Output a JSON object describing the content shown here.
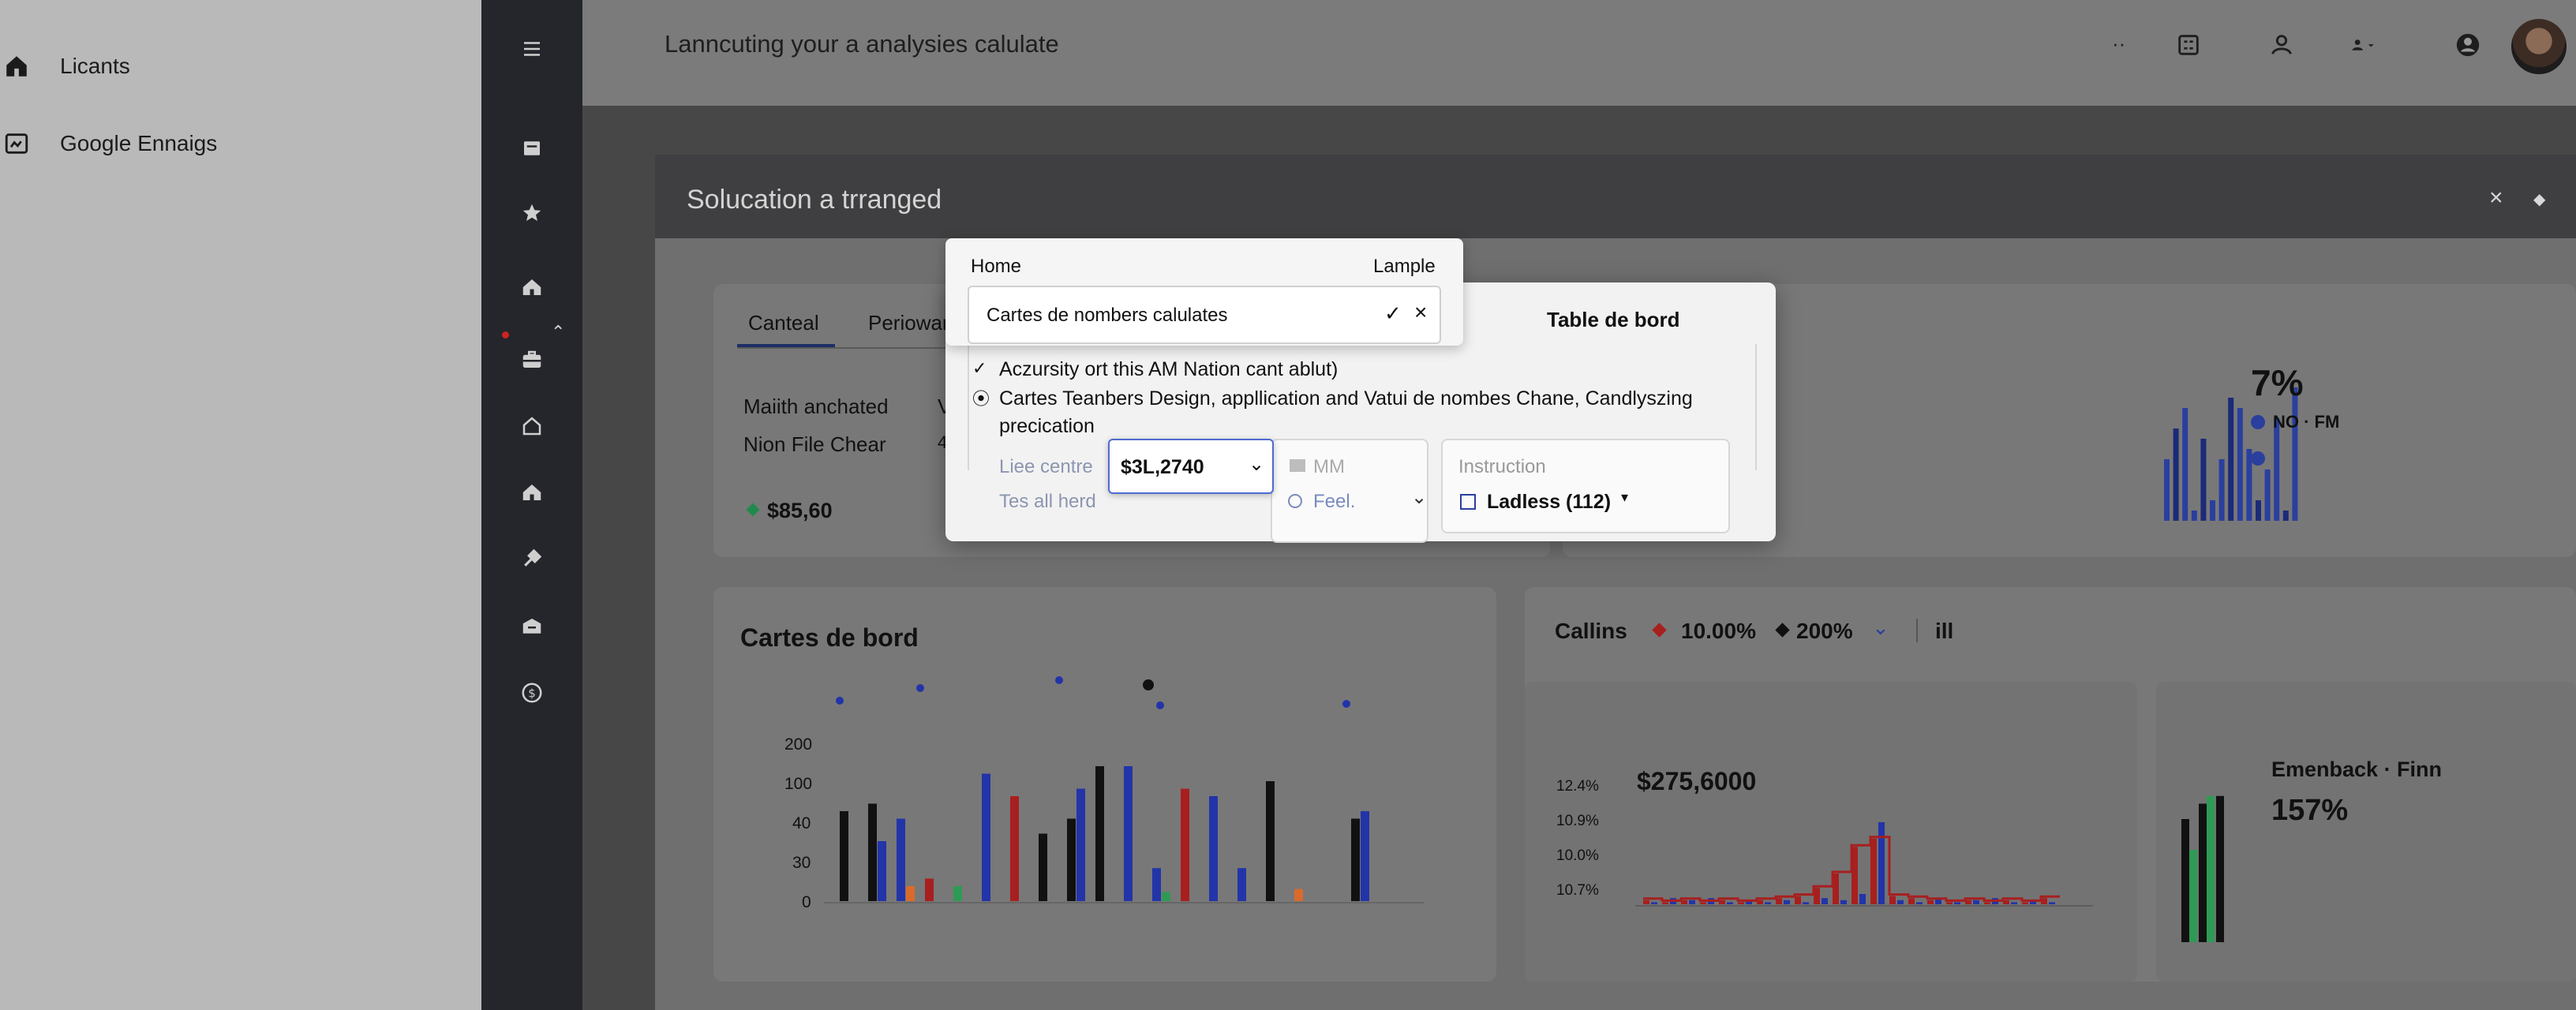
{
  "leftpanel": {
    "items": [
      {
        "label": "Licants",
        "icon": "home-icon"
      },
      {
        "label": "Google Ennaigs",
        "icon": "image-icon"
      }
    ]
  },
  "rail": {
    "icons": [
      "menu-icon",
      "layout-icon",
      "star-icon",
      "dashboard-icon",
      "briefcase-icon",
      "home-icon",
      "building-icon",
      "tools-icon",
      "box-icon",
      "dollar-icon"
    ]
  },
  "topbar": {
    "title": "Lanncuting your a analysies calulate",
    "dots": "··"
  },
  "window": {
    "title": "Solucation a trranged",
    "close": "×",
    "pin": "◆"
  },
  "summary": {
    "tabs": [
      "Canteal",
      "Periowar"
    ],
    "rows": [
      "Maiith anchated",
      "Nion File Chear"
    ],
    "row_suffix": [
      "V",
      "4"
    ],
    "amount": "$85,60",
    "amount_color": "#1f8a4c"
  },
  "topright": {
    "percent": "7%",
    "legend1": "NO · FM",
    "bar_color": "#2a3f9e",
    "bars": [
      6,
      9,
      11,
      1,
      8,
      2,
      6,
      12,
      11,
      7,
      2,
      5,
      10,
      1,
      13
    ]
  },
  "dialog": {
    "head_left": "Home",
    "head_right": "Lample",
    "combo_text": "Cartes de nombers calulates",
    "side_title": "Table de bord",
    "check1": "Aczursity ort this AM Nation cant ablut)",
    "check2": "Cartes Teanbers Design, appllication and Vatui de nombes Chane, Candlyszing precication",
    "field_label1": "Liee centre",
    "field_label2": "Tes all herd",
    "select_value": "$3L,2740",
    "mm_label": "MM",
    "feel_label": "Feel.",
    "instruction_label": "Instruction",
    "ladless_label": "Ladless (112)"
  },
  "cartes": {
    "title": "Cartes de bord",
    "yticks": [
      "200",
      "100",
      "40",
      "30",
      "0"
    ],
    "chart_data": {
      "type": "bar",
      "title": "Cartes de bord",
      "yticks": [
        "200",
        "100",
        "40",
        "30",
        "0"
      ],
      "series": [
        {
          "color": "#111111",
          "values": [
            60,
            65,
            0,
            0,
            0,
            0,
            0,
            45,
            55,
            90,
            0,
            0,
            0,
            0,
            0,
            80,
            0,
            0,
            55
          ]
        },
        {
          "color": "#2334a8",
          "values": [
            0,
            40,
            55,
            0,
            0,
            85,
            0,
            0,
            75,
            0,
            90,
            22,
            0,
            70,
            22,
            0,
            0,
            0,
            60
          ]
        },
        {
          "color": "#a81f1f",
          "values": [
            0,
            0,
            0,
            15,
            0,
            0,
            70,
            0,
            0,
            0,
            0,
            0,
            75,
            0,
            0,
            0,
            0,
            0,
            0
          ]
        },
        {
          "color": "#2f9a55",
          "values": [
            0,
            0,
            0,
            0,
            10,
            0,
            0,
            0,
            0,
            0,
            0,
            6,
            0,
            0,
            0,
            0,
            0,
            0,
            0
          ]
        },
        {
          "color": "#d96b2a",
          "values": [
            0,
            0,
            10,
            0,
            0,
            0,
            0,
            0,
            0,
            0,
            0,
            0,
            0,
            0,
            0,
            0,
            8,
            0,
            0
          ]
        }
      ]
    }
  },
  "callins": {
    "title": "Callins",
    "stat1": "10.00%",
    "stat2": "200%",
    "extra": "ill",
    "value": "$275,6000",
    "yticks": [
      "12.4%",
      "10.9%",
      "10.0%",
      "10.7%"
    ],
    "chart_data": {
      "type": "line",
      "yticks": [
        "12.4%",
        "10.9%",
        "10.0%",
        "10.7%"
      ],
      "series": [
        {
          "name": "red",
          "color": "#a81f1f",
          "values": [
            2,
            1,
            2,
            1,
            2,
            1,
            2,
            3,
            4,
            8,
            15,
            28,
            32,
            4,
            3,
            2,
            1,
            2,
            1,
            2,
            1,
            3
          ]
        },
        {
          "name": "blue",
          "color": "#2334a8",
          "values": [
            1,
            3,
            2,
            3,
            1,
            2,
            1,
            2,
            1,
            3,
            2,
            5,
            40,
            2,
            1,
            3,
            1,
            2,
            3,
            1,
            2,
            1
          ]
        }
      ]
    }
  },
  "emenback": {
    "title": "Emenback · Finn",
    "value": "157%",
    "bars": [
      {
        "color": "#111111",
        "value": 80
      },
      {
        "color": "#2f9a55",
        "value": 60
      },
      {
        "color": "#111111",
        "value": 90
      },
      {
        "color": "#2f9a55",
        "value": 95
      },
      {
        "color": "#111111",
        "value": 95
      }
    ]
  },
  "colors": {
    "accent_blue": "#2a3f9e",
    "alert_red": "#a81f1f",
    "positive_green": "#1f8a4c"
  }
}
